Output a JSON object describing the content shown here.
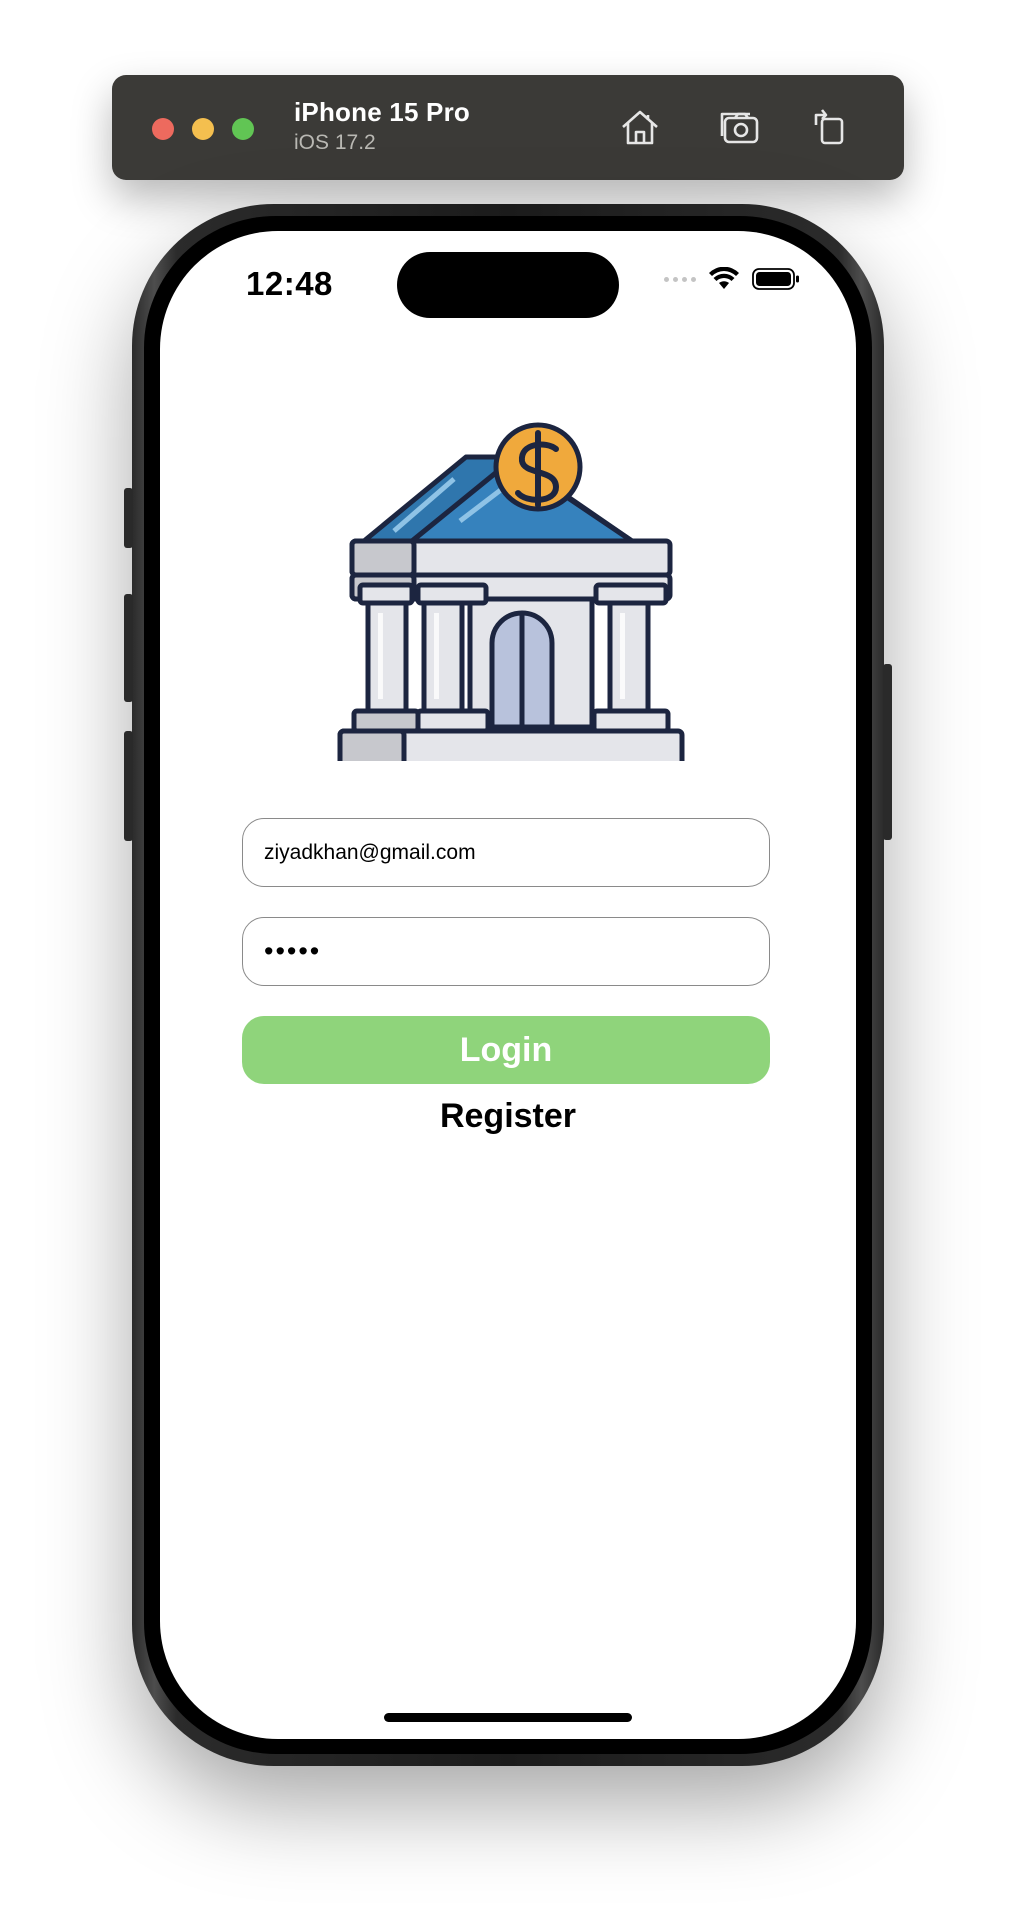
{
  "simulator": {
    "device_name": "iPhone 15 Pro",
    "os_version": "iOS 17.2",
    "toolbar_icons": [
      "home-icon",
      "screenshot-icon",
      "rotate-icon"
    ]
  },
  "status_bar": {
    "time": "12:48",
    "icons": [
      "cellular-signal-icon",
      "wifi-icon",
      "battery-icon"
    ]
  },
  "login": {
    "logo_icon": "bank-dollar-icon",
    "email_value": "ziyadkhan@gmail.com",
    "password_value": "•••••",
    "login_label": "Login",
    "register_label": "Register"
  },
  "colors": {
    "login_button": "#8fd47b",
    "toolbar": "#3b3a37",
    "bank_roof": "#2f76ad",
    "coin": "#f0a93c"
  }
}
